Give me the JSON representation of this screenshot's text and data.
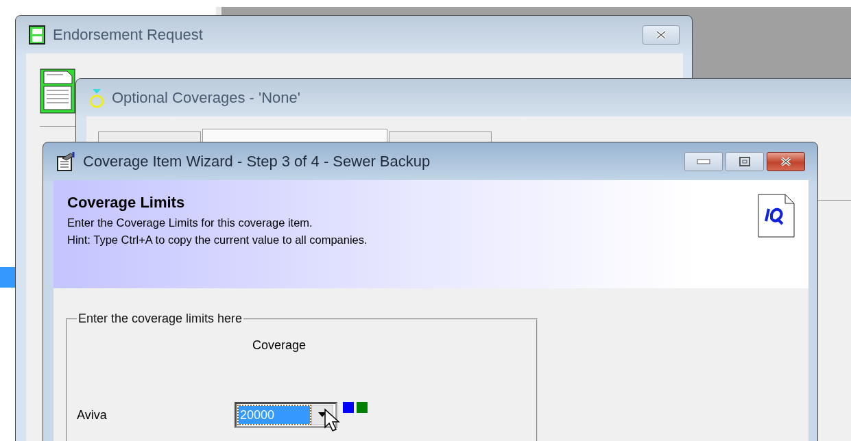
{
  "background_list": {
    "row_selected": true
  },
  "endorsement_window": {
    "title": "Endorsement Request"
  },
  "optional_coverages_window": {
    "title": "Optional Coverages - 'None'",
    "tabs": [
      {
        "selected": false
      },
      {
        "selected": true
      },
      {
        "selected": false
      }
    ]
  },
  "wizard_window": {
    "title": "Coverage Item Wizard - Step 3 of 4 - Sewer Backup",
    "header": {
      "title": "Coverage Limits",
      "lines": [
        "Enter the Coverage Limits for this coverage item.",
        "Hint: Type Ctrl+A to copy the current value to all companies."
      ]
    },
    "group": {
      "legend": "Enter the coverage limits here",
      "column_header": "Coverage",
      "rows": [
        {
          "company": "Aviva",
          "value": "20000",
          "focused": true,
          "indicators": [
            {
              "color": "#0000ff"
            },
            {
              "color": "#008000"
            }
          ]
        }
      ]
    }
  }
}
